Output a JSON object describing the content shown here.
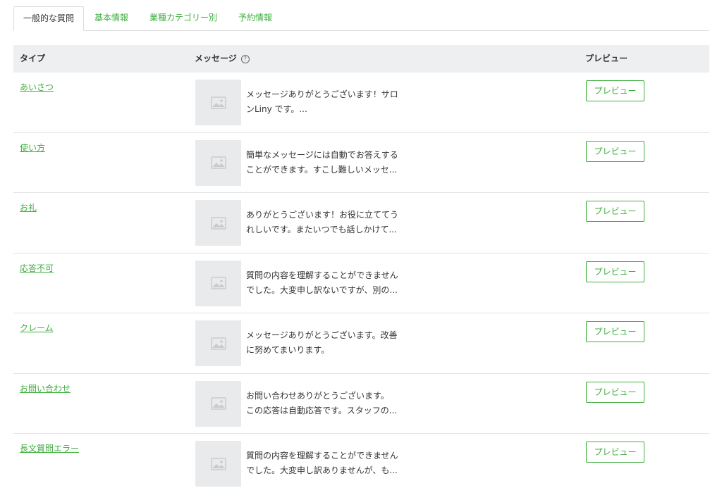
{
  "tabs": [
    {
      "label": "一般的な質問",
      "active": true
    },
    {
      "label": "基本情報",
      "active": false
    },
    {
      "label": "業種カテゴリー別",
      "active": false
    },
    {
      "label": "予約情報",
      "active": false
    }
  ],
  "table": {
    "headers": {
      "type": "タイプ",
      "message": "メッセージ",
      "preview": "プレビュー"
    },
    "help_icon_glyph": "?",
    "rows": [
      {
        "type": "あいさつ",
        "line1": "メッセージありがとうございます！サロ",
        "line2": "ンLiny です。...",
        "preview_label": "プレビュー"
      },
      {
        "type": "使い方",
        "line1": "簡単なメッセージには自動でお答えする",
        "line2": "ことができます。すこし難しいメッセ...",
        "preview_label": "プレビュー"
      },
      {
        "type": "お礼",
        "line1": "ありがとうございます！お役に立ててう",
        "line2": "れしいです。またいつでも話しかけて...",
        "preview_label": "プレビュー"
      },
      {
        "type": "応答不可",
        "line1": "質問の内容を理解することができません",
        "line2": "でした。大変申し訳ないですが、別の...",
        "preview_label": "プレビュー"
      },
      {
        "type": "クレーム",
        "line1": "メッセージありがとうございます。改善",
        "line2": "に努めてまいります。",
        "preview_label": "プレビュー"
      },
      {
        "type": "お問い合わせ",
        "line1": "お問い合わせありがとうございます。",
        "line2": "この応答は自動応答です。スタッフの...",
        "preview_label": "プレビュー"
      },
      {
        "type": "長文質問エラー",
        "line1": "質問の内容を理解することができません",
        "line2": "でした。大変申し訳ありませんが、も...",
        "preview_label": "プレビュー"
      }
    ]
  },
  "colors": {
    "accent": "#3fae3f",
    "header_bg": "#eeeff0",
    "thumb_bg": "#e9eaec"
  }
}
